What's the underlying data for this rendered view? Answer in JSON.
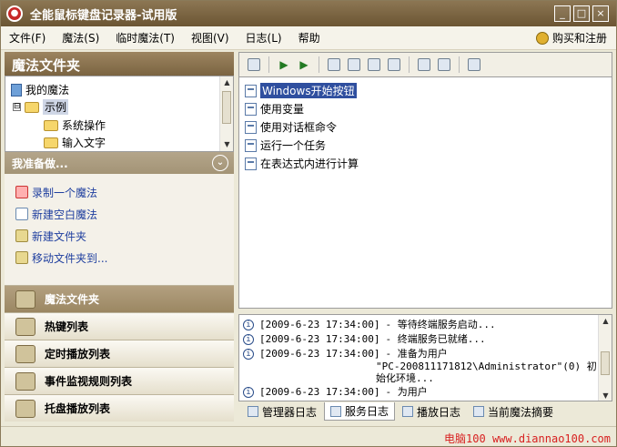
{
  "window": {
    "title": "全能鼠标键盘记录器-试用版",
    "buttons": [
      "_",
      "□",
      "×"
    ]
  },
  "menu": {
    "items": [
      "文件(F)",
      "魔法(S)",
      "临时魔法(T)",
      "视图(V)",
      "日志(L)",
      "帮助"
    ],
    "buy": "购买和注册"
  },
  "left": {
    "title": "魔法文件夹",
    "tree": {
      "root": "我的魔法",
      "expander": "⊟",
      "selected": "示例",
      "children": [
        "系统操作",
        "输入文字"
      ]
    },
    "tasks_title": "我准备做...",
    "tasks": [
      "录制一个魔法",
      "新建空白魔法",
      "新建文件夹",
      "移动文件夹到..."
    ],
    "nav": [
      "魔法文件夹",
      "热键列表",
      "定时播放列表",
      "事件监视规则列表",
      "托盘播放列表"
    ]
  },
  "magic_list": [
    "Windows开始按钮",
    "使用变量",
    "使用对话框命令",
    "运行一个任务",
    "在表达式内进行计算"
  ],
  "log": [
    {
      "time": "[2009-6-23 17:34:00]",
      "msg": "- 等待终端服务启动..."
    },
    {
      "time": "[2009-6-23 17:34:00]",
      "msg": "- 终端服务已就绪..."
    },
    {
      "time": "[2009-6-23 17:34:00]",
      "msg": "- 准备为用户"
    },
    {
      "time": "",
      "msg": "\"PC-200811171812\\Administrator\"(0) 初"
    },
    {
      "time": "",
      "msg": "始化环境..."
    },
    {
      "time": "[2009-6-23 17:34:00]",
      "msg": "-       为用户"
    }
  ],
  "log_tabs": [
    "管理器日志",
    "服务日志",
    "播放日志",
    "当前魔法摘要"
  ],
  "status": {
    "watermark": "电脑100 www.diannao100.com"
  }
}
